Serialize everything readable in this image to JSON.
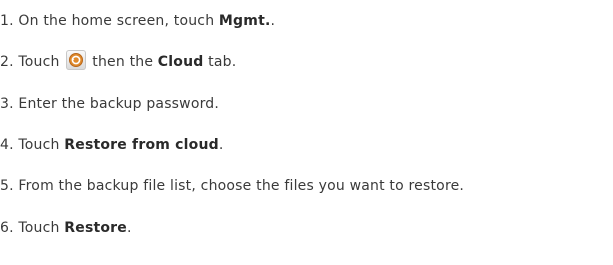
{
  "steps": [
    {
      "num": "1. ",
      "before": "On the home screen, touch ",
      "bold": "Mgmt.",
      "after": "."
    },
    {
      "num": "2. ",
      "before": "Touch",
      "bold": "Cloud",
      "after": " tab.",
      "mid": "then the "
    },
    {
      "num": "3. ",
      "before": "Enter the backup password."
    },
    {
      "num": "4. ",
      "before": "Touch ",
      "bold": "Restore from cloud",
      "after": "."
    },
    {
      "num": "5. ",
      "before": "From the backup file list, choose the files you want to restore."
    },
    {
      "num": "6. ",
      "before": "Touch ",
      "bold": "Restore",
      "after": "."
    }
  ],
  "icons": {
    "backup": "backup-restore-icon"
  }
}
